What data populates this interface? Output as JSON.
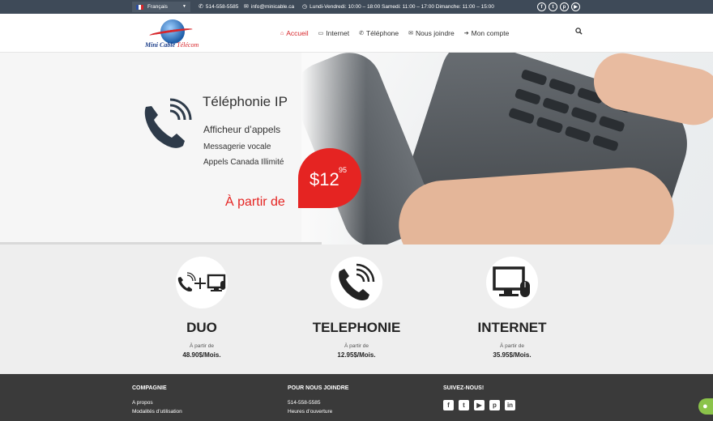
{
  "topbar": {
    "language": "Français",
    "phone": "514-558-5585",
    "email": "info@minicable.ca",
    "hours": "Lundi-Vendredi: 10:00 – 18:00 Samedi: 11:00 – 17:00 Dimanche: 11:00 – 15:00",
    "social_icons": [
      "facebook-icon",
      "twitter-icon",
      "pinterest-icon",
      "youtube-icon"
    ]
  },
  "logo": {
    "part1": "Mini Cable",
    "part2": "Télécom"
  },
  "nav": {
    "items": [
      {
        "label": "Accueil",
        "icon": "home-icon"
      },
      {
        "label": "Internet",
        "icon": "monitor-icon"
      },
      {
        "label": "Téléphone",
        "icon": "phone-icon"
      },
      {
        "label": "Nous joindre",
        "icon": "envelope-icon"
      },
      {
        "label": "Mon compte",
        "icon": "login-icon"
      }
    ]
  },
  "hero": {
    "title": "Téléphonie IP",
    "feature1": "Afficheur d’appels",
    "feature2": "Messagerie vocale",
    "feature3": "Appels Canada Illimité",
    "from_label": "À partir de",
    "price_main": "$12",
    "price_cents": "95"
  },
  "services": [
    {
      "name": "DUO",
      "from": "À partir de",
      "price": "48.90$/Mois."
    },
    {
      "name": "TELEPHONIE",
      "from": "À partir de",
      "price": "12.95$/Mois."
    },
    {
      "name": "INTERNET",
      "from": "À partir de",
      "price": "35.95$/Mois."
    }
  ],
  "footer": {
    "col1": {
      "title": "COMPAGNIE",
      "links": [
        "A propos",
        "Modalités d’utilisation"
      ]
    },
    "col2": {
      "title": "POUR NOUS JOINDRE",
      "links": [
        "514-558-5585",
        "Heures d’ouverture"
      ]
    },
    "col3": {
      "title": "SUIVEZ-NOUS!"
    },
    "social_icons": [
      "facebook-icon",
      "twitter-icon",
      "youtube-icon",
      "pinterest-icon",
      "linkedin-icon"
    ]
  },
  "colors": {
    "accent": "#e52422",
    "topbar": "#3e4a58",
    "footer": "#3a3a3a"
  }
}
